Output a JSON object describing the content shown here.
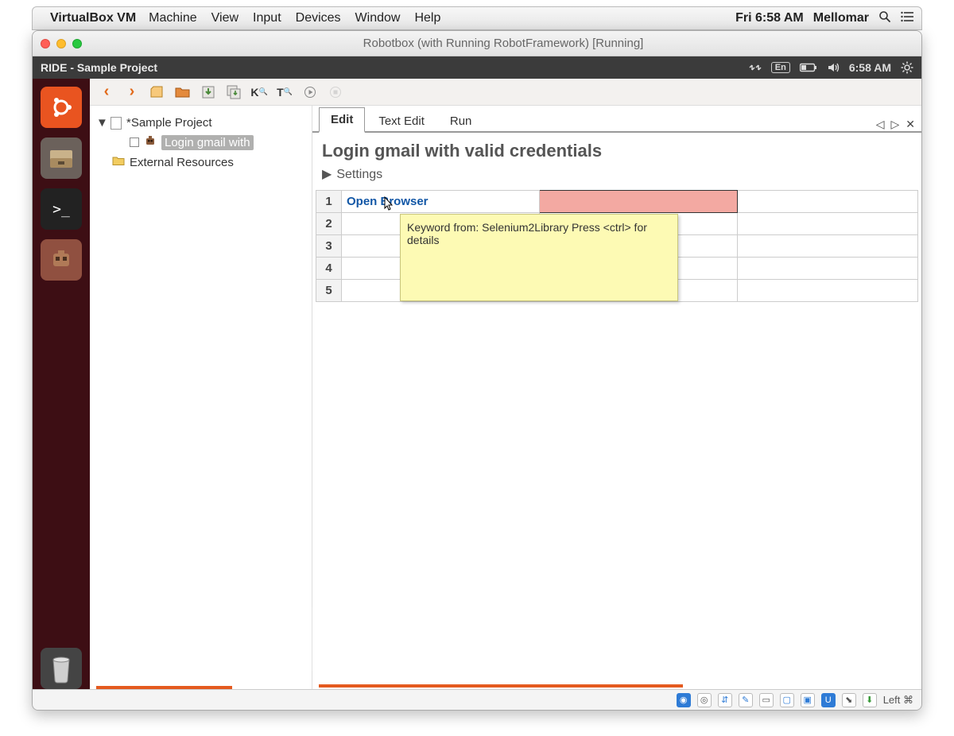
{
  "mac_menubar": {
    "app_name": "VirtualBox VM",
    "menus": [
      "Machine",
      "View",
      "Input",
      "Devices",
      "Window",
      "Help"
    ],
    "clock": "Fri 6:58 AM",
    "user": "Mellomar"
  },
  "vm_window": {
    "title": "Robotbox (with Running RobotFramework) [Running]"
  },
  "guest_panel": {
    "title": "RIDE - Sample Project",
    "lang": "En",
    "clock": "6:58 AM"
  },
  "launcher": {
    "items": [
      "ubuntu-dash",
      "files",
      "terminal",
      "robot-app"
    ],
    "trash_label": "trash"
  },
  "ride": {
    "toolbar": {
      "k_label": "K",
      "t_label": "T"
    },
    "tree": {
      "project": "*Sample Project",
      "testcase": "Login gmail with",
      "ext_res": "External Resources"
    },
    "tabs": {
      "edit": "Edit",
      "text_edit": "Text Edit",
      "run": "Run"
    },
    "editor": {
      "title": "Login gmail with valid credentials",
      "settings": "Settings",
      "rows": [
        "1",
        "2",
        "3",
        "4",
        "5"
      ],
      "row1": {
        "c1": "Open Browser",
        "c2": "",
        "c3": ""
      },
      "tooltip": "Keyword from: Selenium2Library Press <ctrl> for details"
    }
  },
  "vm_status": {
    "host_key": "Left ⌘"
  }
}
